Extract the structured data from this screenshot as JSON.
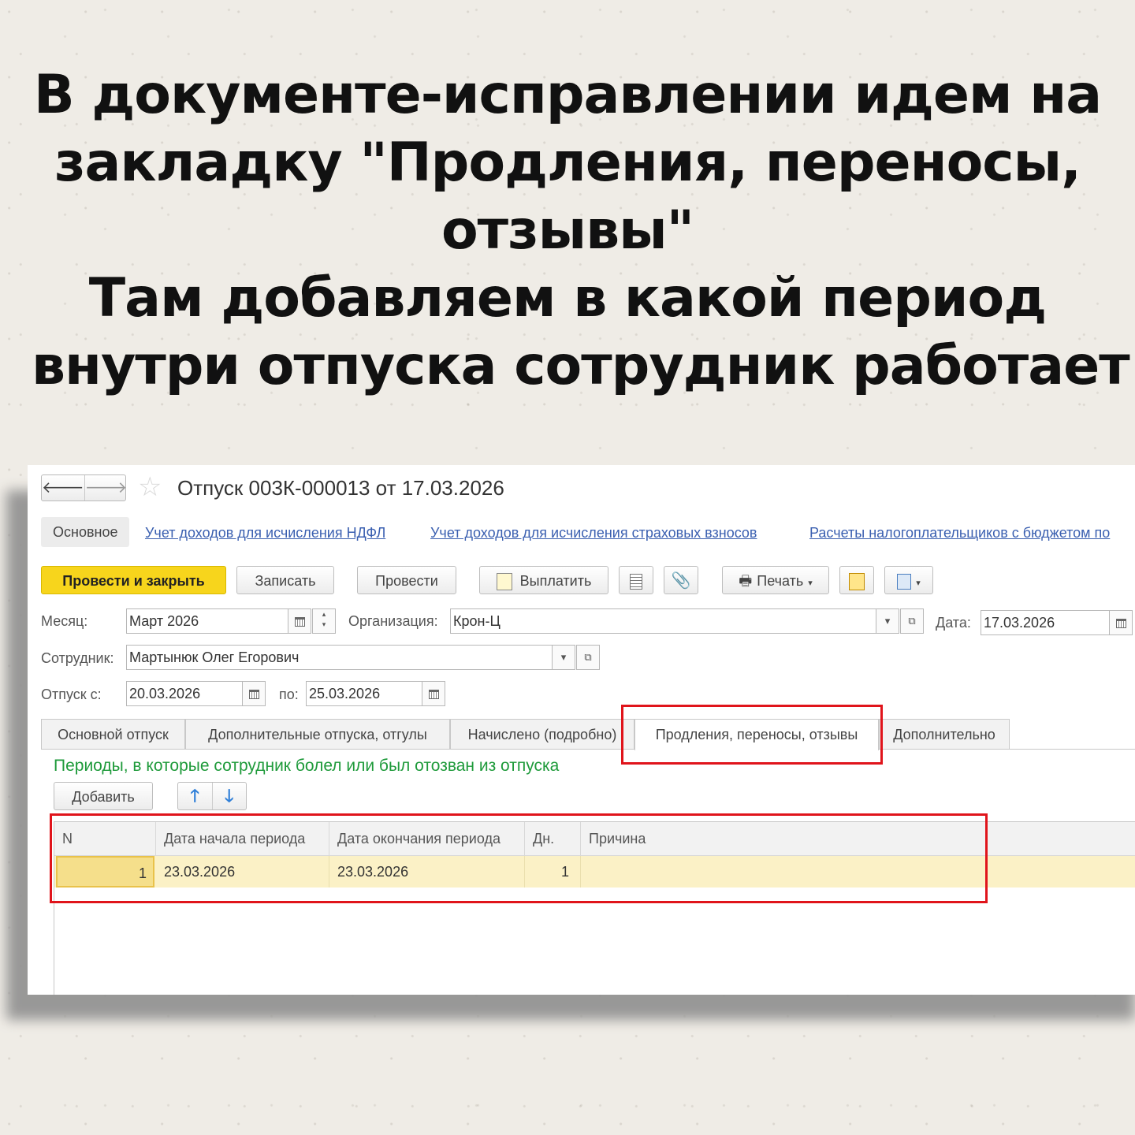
{
  "headline": {
    "line1": "В документе-исправлении идем на",
    "line2": "закладку \"Продления, переносы,",
    "line3": "отзывы\"",
    "line4": "Там добавляем в какой период",
    "line5": "внутри отпуска сотрудник работает"
  },
  "window": {
    "title": "Отпуск 003К-000013 от 17.03.2026",
    "nav": {
      "back": "🡐",
      "forward": "🡒"
    },
    "linkbar": {
      "main_tab": "Основное",
      "links": [
        "Учет доходов для исчисления НДФЛ",
        "Учет доходов для исчисления страховых взносов",
        "Расчеты налогоплательщиков с бюджетом по"
      ]
    },
    "toolbar": {
      "post_close": "Провести и закрыть",
      "save": "Записать",
      "post": "Провести",
      "pay": "Выплатить",
      "print": "Печать"
    },
    "form": {
      "month_label": "Месяц:",
      "month_value": "Март 2026",
      "org_label": "Организация:",
      "org_value": "Крон-Ц",
      "date_label": "Дата:",
      "date_value": "17.03.2026",
      "employee_label": "Сотрудник:",
      "employee_value": "Мартынюк Олег Егорович",
      "from_label": "Отпуск с:",
      "from_value": "20.03.2026",
      "to_label": "по:",
      "to_value": "25.03.2026"
    },
    "tabs": [
      "Основной отпуск",
      "Дополнительные отпуска, отгулы",
      "Начислено (подробно)",
      "Продления, переносы, отзывы",
      "Дополнительно"
    ],
    "section_title": "Периоды, в которые сотрудник болел или был отозван из отпуска",
    "add_button": "Добавить",
    "table": {
      "headers": [
        "N",
        "Дата начала периода",
        "Дата окончания периода",
        "Дн.",
        "Причина"
      ],
      "rows": [
        {
          "n": "1",
          "start": "23.03.2026",
          "end": "23.03.2026",
          "days": "1",
          "reason": ""
        }
      ]
    }
  },
  "colors": {
    "highlight_red": "#e0141b",
    "primary_button": "#f7d51c",
    "link_blue": "#3a5fb0",
    "section_green": "#1e9a3a",
    "row_highlight": "#fbf1c6"
  }
}
